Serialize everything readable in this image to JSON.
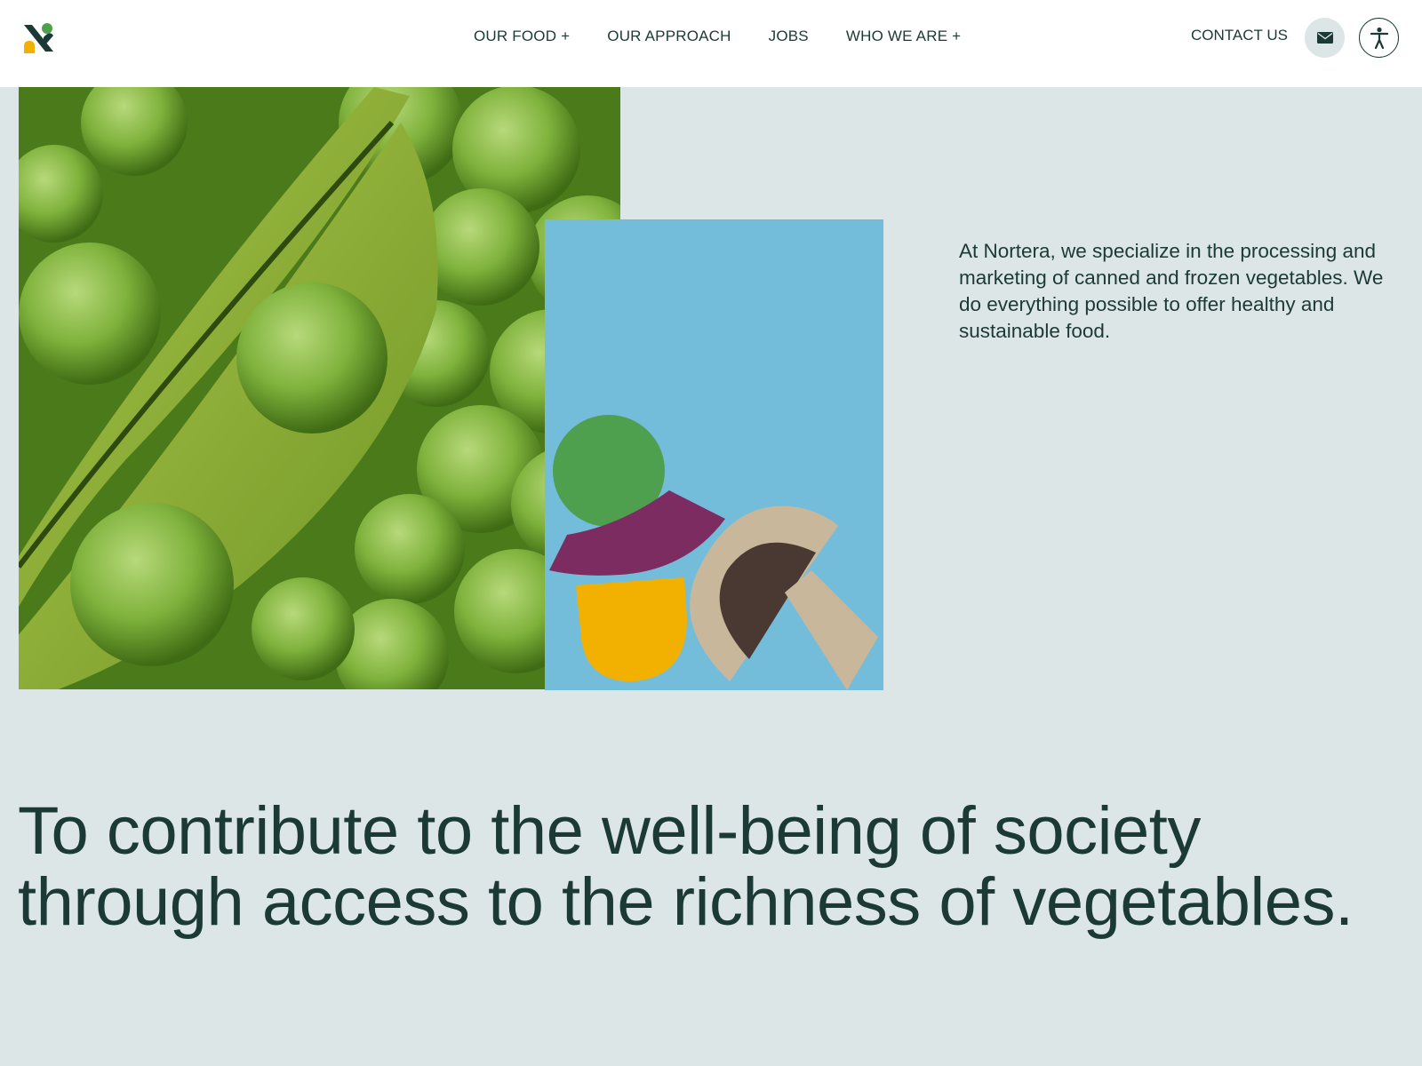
{
  "brand": {
    "logo_icon": "nortera-logo-icon",
    "colors": {
      "dark_green": "#1c3a35",
      "background": "#dce6e7",
      "art_blue": "#73bddb",
      "green": "#4e9f4e",
      "purple": "#7d2c62",
      "yellow": "#f2b000",
      "beige": "#c8b79a",
      "brown": "#4a3833"
    }
  },
  "header": {
    "nav": [
      {
        "label": "OUR FOOD +"
      },
      {
        "label": "OUR APPROACH"
      },
      {
        "label": "JOBS"
      },
      {
        "label": "WHO WE ARE +"
      }
    ],
    "contact_label": "CONTACT US",
    "mail_icon": "mail-icon",
    "accessibility_icon": "accessibility-icon"
  },
  "hero": {
    "photo_subject": "pea-pods-photo",
    "illustration": "abstract-vegetables-illustration"
  },
  "intro_text": "At Nortera, we specialize in the processing and marketing of canned and frozen vegetables. We do everything possible to offer healthy and sustainable food.",
  "mission_text": "To contribute to the well-being of society through access to the richness of vegetables."
}
